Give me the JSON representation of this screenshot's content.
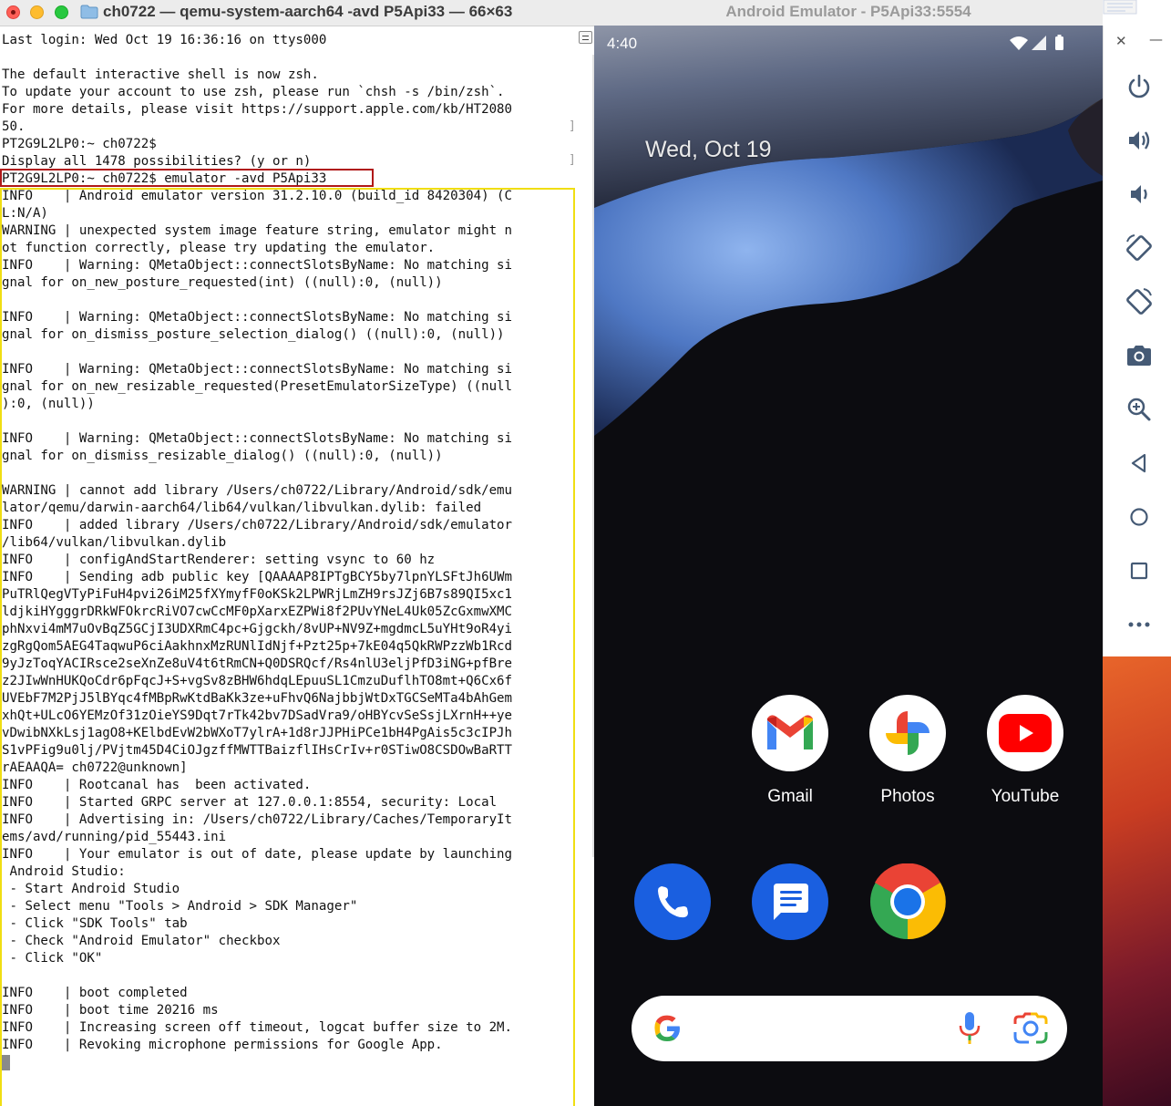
{
  "terminal": {
    "title": "ch0722 — qemu-system-aarch64 -avd P5Api33 — 66×63",
    "lines": [
      "Last login: Wed Oct 19 16:36:16 on ttys000",
      "",
      "The default interactive shell is now zsh.",
      "To update your account to use zsh, please run `chsh -s /bin/zsh`.",
      "For more details, please visit https://support.apple.com/kb/HT2080",
      "50.",
      "PT2G9L2LP0:~ ch0722$",
      "Display all 1478 possibilities? (y or n)",
      "PT2G9L2LP0:~ ch0722$ emulator -avd P5Api33",
      "INFO    | Android emulator version 31.2.10.0 (build_id 8420304) (C",
      "L:N/A)",
      "WARNING | unexpected system image feature string, emulator might n",
      "ot function correctly, please try updating the emulator.",
      "INFO    | Warning: QMetaObject::connectSlotsByName: No matching si",
      "gnal for on_new_posture_requested(int) ((null):0, (null))",
      "",
      "INFO    | Warning: QMetaObject::connectSlotsByName: No matching si",
      "gnal for on_dismiss_posture_selection_dialog() ((null):0, (null))",
      "",
      "INFO    | Warning: QMetaObject::connectSlotsByName: No matching si",
      "gnal for on_new_resizable_requested(PresetEmulatorSizeType) ((null",
      "):0, (null))",
      "",
      "INFO    | Warning: QMetaObject::connectSlotsByName: No matching si",
      "gnal for on_dismiss_resizable_dialog() ((null):0, (null))",
      "",
      "WARNING | cannot add library /Users/ch0722/Library/Android/sdk/emu",
      "lator/qemu/darwin-aarch64/lib64/vulkan/libvulkan.dylib: failed",
      "INFO    | added library /Users/ch0722/Library/Android/sdk/emulator",
      "/lib64/vulkan/libvulkan.dylib",
      "INFO    | configAndStartRenderer: setting vsync to 60 hz",
      "INFO    | Sending adb public key [QAAAAP8IPTgBCY5by7lpnYLSFtJh6UWm",
      "PuTRlQegVTyPiFuH4pvi26iM25fXYmyfF0oKSk2LPWRjLmZH9rsJZj6B7s89QI5xc1",
      "ldjkiHYgggrDRkWFOkrcRiVO7cwCcMF0pXarxEZPWi8f2PUvYNeL4Uk05ZcGxmwXMC",
      "phNxvi4mM7uOvBqZ5GCjI3UDXRmC4pc+Gjgckh/8vUP+NV9Z+mgdmcL5uYHt9oR4yi",
      "zgRgQom5AEG4TaqwuP6ciAakhnxMzRUNlIdNjf+Pzt25p+7kE04q5QkRWPzzWb1Rcd",
      "9yJzToqYACIRsce2seXnZe8uV4t6tRmCN+Q0DSRQcf/Rs4nlU3eljPfD3iNG+pfBre",
      "z2JIwWnHUKQoCdr6pFqcJ+S+vgSv8zBHW6hdqLEpuuSL1CmzuDuflhTO8mt+Q6Cx6f",
      "UVEbF7M2PjJ5lBYqc4fMBpRwKtdBaKk3ze+uFhvQ6NajbbjWtDxTGCSeMTa4bAhGem",
      "xhQt+ULcO6YEMzOf31zOieYS9Dqt7rTk42bv7DSadVra9/oHBYcvSeSsjLXrnH++ye",
      "vDwibNXkLsj1agO8+KElbdEvW2bWXoT7ylrA+1d8rJJPHiPCe1bH4PgAis5c3cIPJh",
      "S1vPFig9u0lj/PVjtm45D4CiOJgzffMWTTBaizflIHsCrIv+r0STiwO8CSDOwBaRTT",
      "rAEAAQA= ch0722@unknown]",
      "INFO    | Rootcanal has  been activated.",
      "INFO    | Started GRPC server at 127.0.0.1:8554, security: Local",
      "INFO    | Advertising in: /Users/ch0722/Library/Caches/TemporaryIt",
      "ems/avd/running/pid_55443.ini",
      "INFO    | Your emulator is out of date, please update by launching",
      " Android Studio:",
      " - Start Android Studio",
      " - Select menu \"Tools > Android > SDK Manager\"",
      " - Click \"SDK Tools\" tab",
      " - Check \"Android Emulator\" checkbox",
      " - Click \"OK\"",
      "",
      "INFO    | boot completed",
      "INFO    | boot time 20216 ms",
      "INFO    | Increasing screen off timeout, logcat buffer size to 2M.",
      "INFO    | Revoking microphone permissions for Google App."
    ]
  },
  "emulator": {
    "title": "Android Emulator - P5Api33:5554",
    "status_time": "4:40",
    "date": "Wed, Oct 19",
    "apps_row1": [
      {
        "label": "Gmail",
        "icon": "gmail-icon"
      },
      {
        "label": "Photos",
        "icon": "photos-icon"
      },
      {
        "label": "YouTube",
        "icon": "youtube-icon"
      }
    ],
    "apps_row2": [
      {
        "icon": "phone-icon"
      },
      {
        "icon": "messages-icon"
      },
      {
        "icon": "chrome-icon"
      }
    ],
    "search_bar": {
      "icons": [
        "google-g-icon",
        "mic-icon",
        "lens-icon"
      ]
    },
    "toolbar": {
      "buttons": [
        "power-icon",
        "volume-up-icon",
        "volume-down-icon",
        "rotate-left-icon",
        "rotate-right-icon",
        "camera-icon",
        "zoom-icon",
        "back-icon",
        "home-icon",
        "overview-icon",
        "more-icon"
      ]
    }
  },
  "colors": {
    "terminal_highlight_command": "#b01818",
    "terminal_highlight_output": "#f0de12",
    "youtube_red": "#ff0000",
    "google_blue": "#1a73e8"
  }
}
